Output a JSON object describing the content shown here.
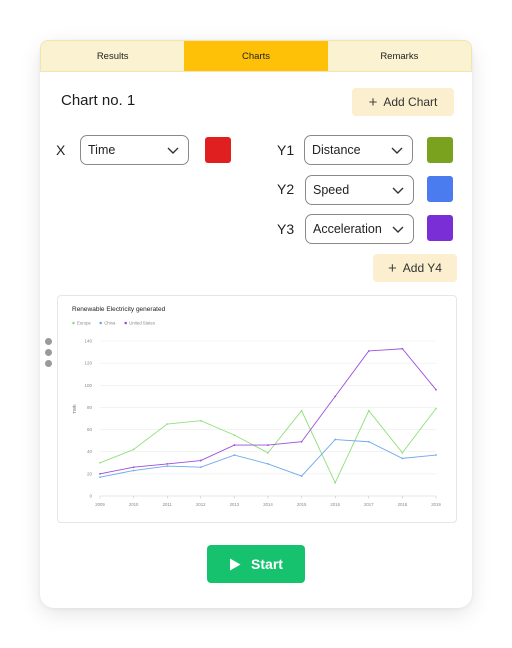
{
  "tabs": [
    {
      "label": "Results",
      "active": false
    },
    {
      "label": "Charts",
      "active": true
    },
    {
      "label": "Remarks",
      "active": false
    }
  ],
  "chart_heading": "Chart no. 1",
  "add_chart_label": "Add Chart",
  "axes": [
    {
      "label": "X",
      "value": "Time",
      "color": "#e02020"
    },
    {
      "label": "Y1",
      "value": "Distance",
      "color": "#7aa21f"
    },
    {
      "label": "Y2",
      "value": "Speed",
      "color": "#4a7cf0"
    },
    {
      "label": "Y3",
      "value": "Acceleration",
      "color": "#7a2fd6"
    }
  ],
  "add_y_label": "Add Y4",
  "start_label": "Start",
  "colors": {
    "accent": "#ffc107",
    "tab_bg": "#faf2d0",
    "button_soft": "#fbefcf",
    "start": "#17c26f"
  },
  "chart_data": {
    "type": "line",
    "title": "Renewable Electricity generated",
    "ylabel": "TWh",
    "xlabel": "",
    "x": [
      "2009",
      "2010",
      "2011",
      "2012",
      "2013",
      "2014",
      "2015",
      "2016",
      "2017",
      "2018",
      "2019"
    ],
    "ylim": [
      0,
      140
    ],
    "yticks": [
      0,
      20,
      40,
      60,
      80,
      100,
      120,
      140
    ],
    "grid": true,
    "legend_position": "top-left",
    "series": [
      {
        "name": "Europe",
        "color": "#8fe07a",
        "values": [
          30,
          42,
          65,
          68,
          55,
          39,
          77,
          12,
          77,
          39,
          79
        ]
      },
      {
        "name": "China",
        "color": "#6ea8f0",
        "values": [
          17,
          23,
          27,
          26,
          37,
          29,
          18,
          51,
          49,
          34,
          37
        ]
      },
      {
        "name": "United States",
        "color": "#9b4fdc",
        "values": [
          20,
          26,
          29,
          32,
          46,
          46,
          49,
          90,
          131,
          133,
          96
        ]
      }
    ]
  }
}
